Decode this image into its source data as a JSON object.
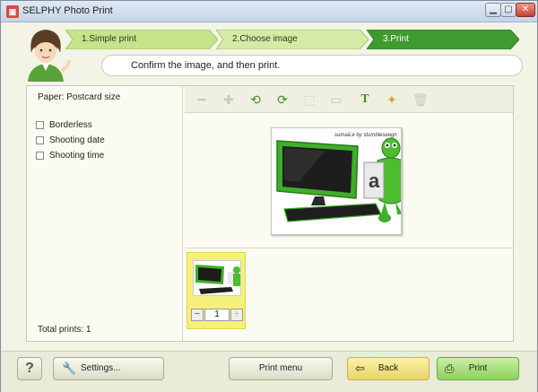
{
  "window": {
    "title": "SELPHY Photo Print",
    "min_icon": "minimize-icon",
    "max_icon": "maximize-icon",
    "close_icon": "close-icon"
  },
  "steps": [
    {
      "label": "1.Simple print",
      "state": "done"
    },
    {
      "label": "2.Choose image",
      "state": "done"
    },
    {
      "label": "3.Print",
      "state": "current"
    }
  ],
  "instruction": "Confirm the image, and then print.",
  "left_panel": {
    "paper": "Paper: Postcard size",
    "options": [
      {
        "label": "Borderless",
        "checked": false
      },
      {
        "label": "Shooting date",
        "checked": false
      },
      {
        "label": "Shooting time",
        "checked": false
      }
    ],
    "total_prints": "Total prints: 1"
  },
  "toolbar": {
    "tools": [
      {
        "name": "zoom-out-icon",
        "enabled": false
      },
      {
        "name": "zoom-in-icon",
        "enabled": false
      },
      {
        "name": "rotate-left-icon",
        "enabled": true
      },
      {
        "name": "rotate-right-icon",
        "enabled": true
      },
      {
        "name": "crop-icon",
        "enabled": false
      },
      {
        "name": "frame-icon",
        "enabled": false
      },
      {
        "name": "text-icon",
        "enabled": true
      },
      {
        "name": "add-image-icon",
        "enabled": true
      },
      {
        "name": "delete-icon",
        "enabled": false
      }
    ]
  },
  "preview": {
    "caption": "sumaiLe by stumbleseegn"
  },
  "thumbnail": {
    "quantity": "1",
    "minus_icon": "minus-icon",
    "plus_icon": "plus-icon"
  },
  "footer": {
    "help_label": "?",
    "settings_label": "Settings...",
    "print_menu_label": "Print menu",
    "back_label": "Back",
    "print_label": "Print"
  },
  "colors": {
    "step_done": "#c6e38c",
    "step_current": "#3f9a2f",
    "back_button": "#f2e287",
    "print_button": "#a9e07b",
    "thumb_highlight": "#f5f07a"
  }
}
